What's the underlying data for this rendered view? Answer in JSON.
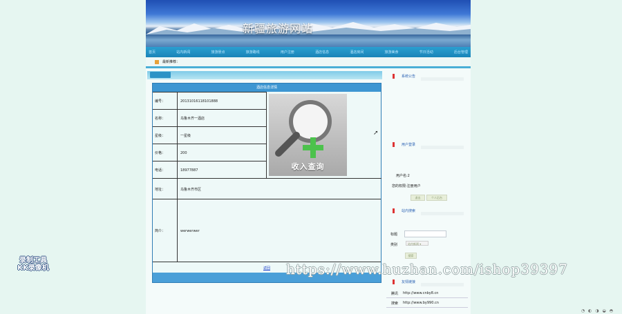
{
  "header": {
    "site_title": "新疆旅游网站"
  },
  "nav": {
    "items": [
      "首页",
      "站内新闻",
      "旅游景点",
      "旅游路线",
      "用户注册",
      "酒店信息",
      "酒店房间",
      "旅游美食",
      "节日活动",
      "后台管理"
    ]
  },
  "newsbar": {
    "label": "最新推荐："
  },
  "detail": {
    "caption": "酒店信息详情",
    "rows": [
      {
        "label": "编号：",
        "value": "20131016118101888"
      },
      {
        "label": "名称：",
        "value": "乌鲁木齐一酒店"
      },
      {
        "label": "星级：",
        "value": "一星级"
      },
      {
        "label": "价格：",
        "value": "200"
      },
      {
        "label": "电话：",
        "value": "18977887"
      },
      {
        "label": "地址：",
        "value": "乌鲁木齐市区"
      },
      {
        "label": "简介：",
        "value": "werwerwer"
      }
    ],
    "image_caption": "收入查询",
    "back_label": "返回"
  },
  "sidebar": {
    "announce_title": "系统公告",
    "login_title": "用户登录",
    "username_text": "用户名:2",
    "role_text": "您的权限:注册用户",
    "logout_label": "退出",
    "profile_label": "个人后台",
    "search_title": "站内搜索",
    "search_title_label": "标题",
    "search_category_label": "类别",
    "search_category_value": "站内新闻",
    "search_button": "搜索",
    "links_title": "友情链接",
    "links": [
      {
        "name": "腾讯",
        "url": "http://www.cnby8.cn"
      },
      {
        "name": "搜索",
        "url": "http://www.by990.cn"
      }
    ]
  },
  "overlay": {
    "watermark": "https://www.huzhan.com/ishop39397",
    "recorder_line1": "录制工具",
    "recorder_line2": "KK录像机"
  },
  "colors": {
    "nav": "#1a84b8",
    "accent": "#3d96d2",
    "background": "#e6f6f1"
  }
}
